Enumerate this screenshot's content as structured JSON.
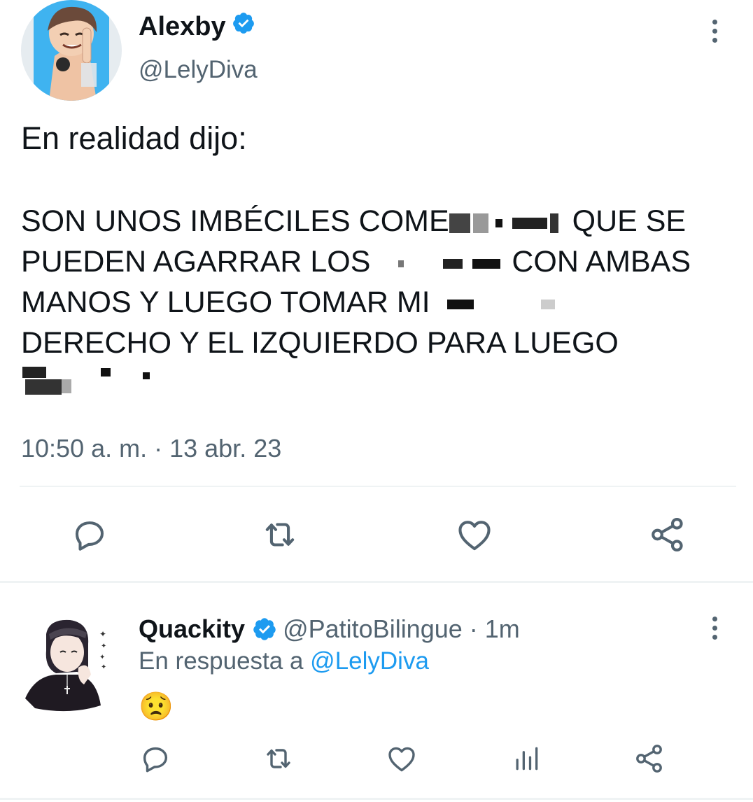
{
  "tweet": {
    "display_name": "Alexby",
    "handle": "@LelyDiva",
    "verified_icon": "verified-badge-icon",
    "intro": "En realidad dijo:",
    "shout_lines": [
      [
        "SON UNOS IMBÉCILES COME",
        "QUE SE"
      ],
      [
        "PUEDEN AGARRAR LOS",
        "CON AMBAS"
      ],
      [
        "MANOS Y LUEGO TOMAR MI",
        ""
      ],
      [
        "DERECHO Y EL IZQUIERDO PARA LUEGO",
        ""
      ]
    ],
    "timestamp": "10:50 a. m. · 13 abr. 23",
    "actions": [
      "reply-icon",
      "retweet-icon",
      "like-icon",
      "share-icon"
    ]
  },
  "reply": {
    "display_name": "Quackity",
    "meta": "@PatitoBilingue · 1m",
    "reply_prefix": "En respuesta a",
    "reply_handle": "@LelyDiva",
    "emoji": "😟",
    "actions": [
      "reply-icon",
      "retweet-icon",
      "like-icon",
      "analytics-icon",
      "share-icon"
    ]
  },
  "colors": {
    "verified": "#1d9bf0",
    "secondary_text": "#536471",
    "icon": "#536471",
    "divider": "#eff3f4"
  }
}
